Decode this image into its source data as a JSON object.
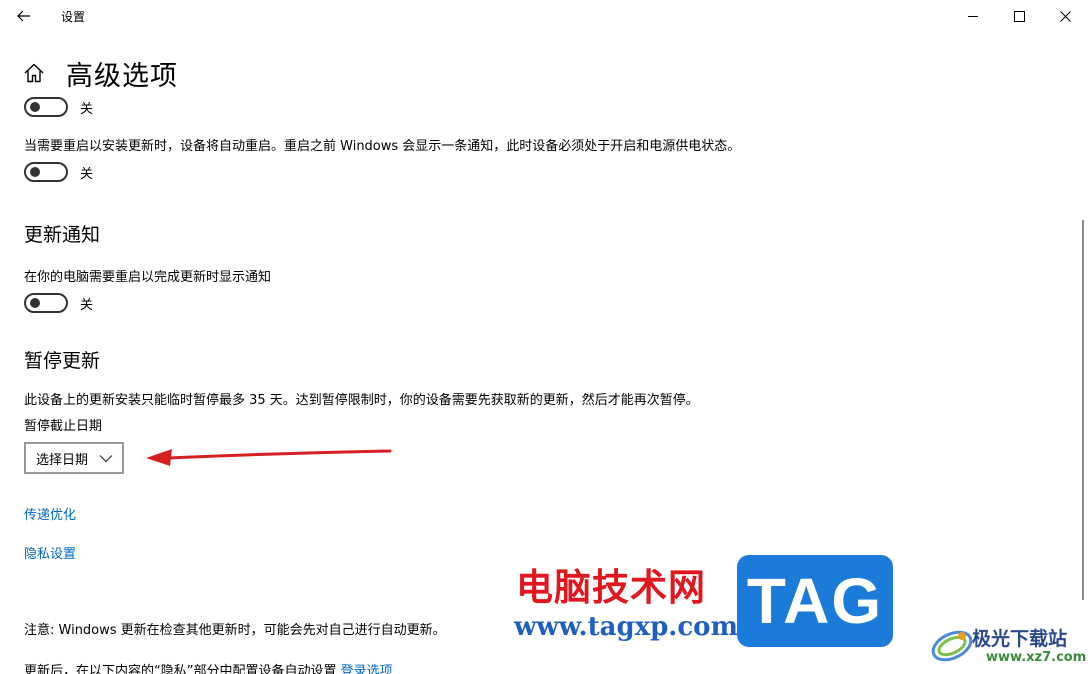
{
  "window": {
    "title": "设置",
    "minimize_label": "Minimize",
    "maximize_label": "Maximize",
    "close_label": "Close"
  },
  "page": {
    "title": "高级选项"
  },
  "toggles": [
    {
      "state_label": "关"
    },
    {
      "state_label": "关"
    },
    {
      "state_label": "关"
    }
  ],
  "restart_notice": {
    "description": "当需要重启以安装更新时，设备将自动重启。重启之前 Windows 会显示一条通知，此时设备必须处于开启和电源供电状态。"
  },
  "update_notifications": {
    "heading": "更新通知",
    "description": "在你的电脑需要重启以完成更新时显示通知"
  },
  "pause_updates": {
    "heading": "暂停更新",
    "description": "此设备上的更新安装只能临时暂停最多 35 天。达到暂停限制时，你的设备需要先获取新的更新，然后才能再次暂停。",
    "field_label": "暂停截止日期",
    "dropdown_value": "选择日期"
  },
  "links": {
    "delivery_optimization": "传递优化",
    "privacy_settings": "隐私设置"
  },
  "footer": {
    "note": "注意: Windows 更新在检查其他更新时，可能会先对自己进行自动更新。",
    "privacy_note": "更新后，在以下内容的“隐私”部分中配置设备自动设置",
    "login_options_link": "登录选项"
  },
  "watermarks": {
    "site_cn": "电脑技术网",
    "site_url": "www.tagxp.com",
    "tag_logo": "TAG",
    "site2_name": "极光下载站",
    "site2_url": "www.xz7.com"
  },
  "colors": {
    "link": "#0067c0",
    "annotation_arrow": "#d42020",
    "tag_bg": "#1a7bd8",
    "watermark_red": "#e0171f"
  }
}
